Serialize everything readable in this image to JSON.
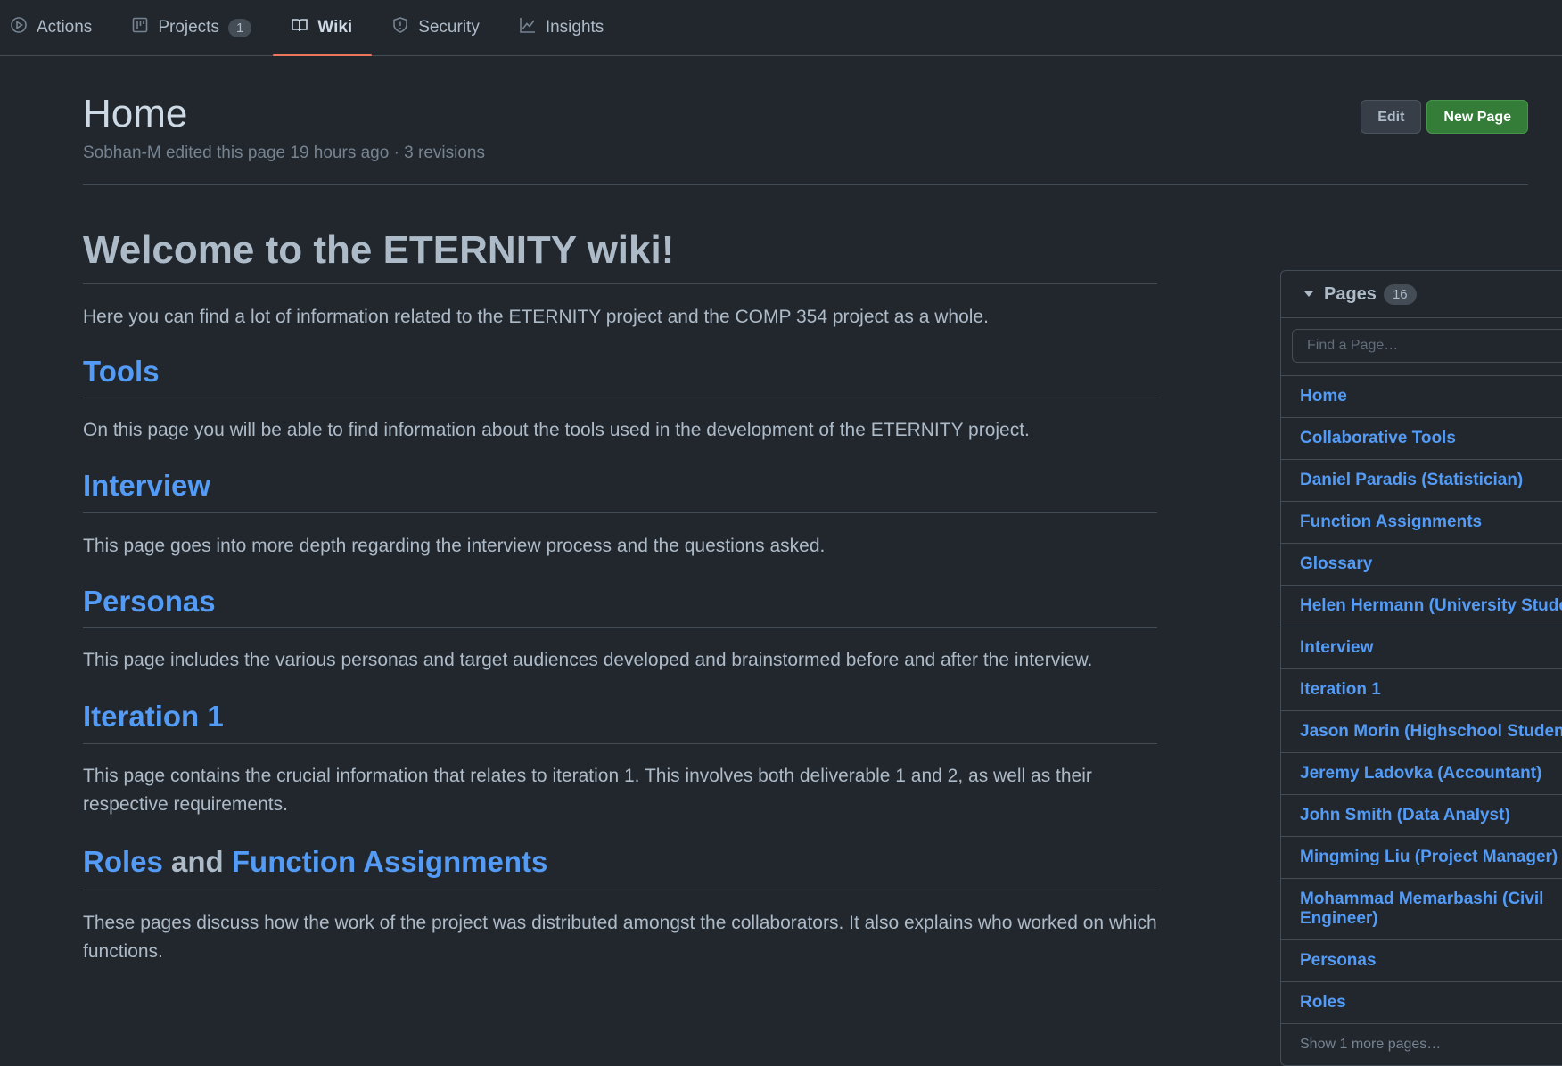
{
  "nav": {
    "tabs": [
      {
        "label": "Actions"
      },
      {
        "label": "Projects",
        "count": "1"
      },
      {
        "label": "Wiki"
      },
      {
        "label": "Security"
      },
      {
        "label": "Insights"
      }
    ]
  },
  "header": {
    "title": "Home",
    "meta": "Sobhan-M edited this page 19 hours ago · 3 revisions",
    "edit_label": "Edit",
    "new_page_label": "New Page"
  },
  "content": {
    "heading": "Welcome to the ETERNITY wiki!",
    "intro": "Here you can find a lot of information related to the ETERNITY project and the COMP 354 project as a whole.",
    "sections": [
      {
        "title": "Tools",
        "text": "On this page you will be able to find information about the tools used in the development of the ETERNITY project."
      },
      {
        "title": "Interview",
        "text": "This page goes into more depth regarding the interview process and the questions asked."
      },
      {
        "title": "Personas",
        "text": "This page includes the various personas and target audiences developed and brainstormed before and after the interview."
      },
      {
        "title": "Iteration 1",
        "text": "This page contains the crucial information that relates to iteration 1. This involves both deliverable 1 and 2, as well as their respective requirements."
      }
    ],
    "roles_section": {
      "link1": "Roles",
      "joiner": "and",
      "link2": "Function Assignments",
      "text": "These pages discuss how the work of the project was distributed amongst the collaborators. It also explains who worked on which functions."
    }
  },
  "sidebar": {
    "title": "Pages",
    "count": "16",
    "search_placeholder": "Find a Page…",
    "pages": [
      "Home",
      "Collaborative Tools",
      "Daniel Paradis (Statistician)",
      "Function Assignments",
      "Glossary",
      "Helen Hermann (University Student)",
      "Interview",
      "Iteration 1",
      "Jason Morin (Highschool Student)",
      "Jeremy Ladovka (Accountant)",
      "John Smith (Data Analyst)",
      "Mingming Liu (Project Manager)",
      "Mohammad Memarbashi (Civil Engineer)",
      "Personas",
      "Roles"
    ],
    "more_label": "Show 1 more pages…"
  },
  "colors": {
    "background": "#22272e",
    "link": "#539bf5",
    "accent_underline": "#ec775c",
    "primary_button": "#347d39"
  }
}
